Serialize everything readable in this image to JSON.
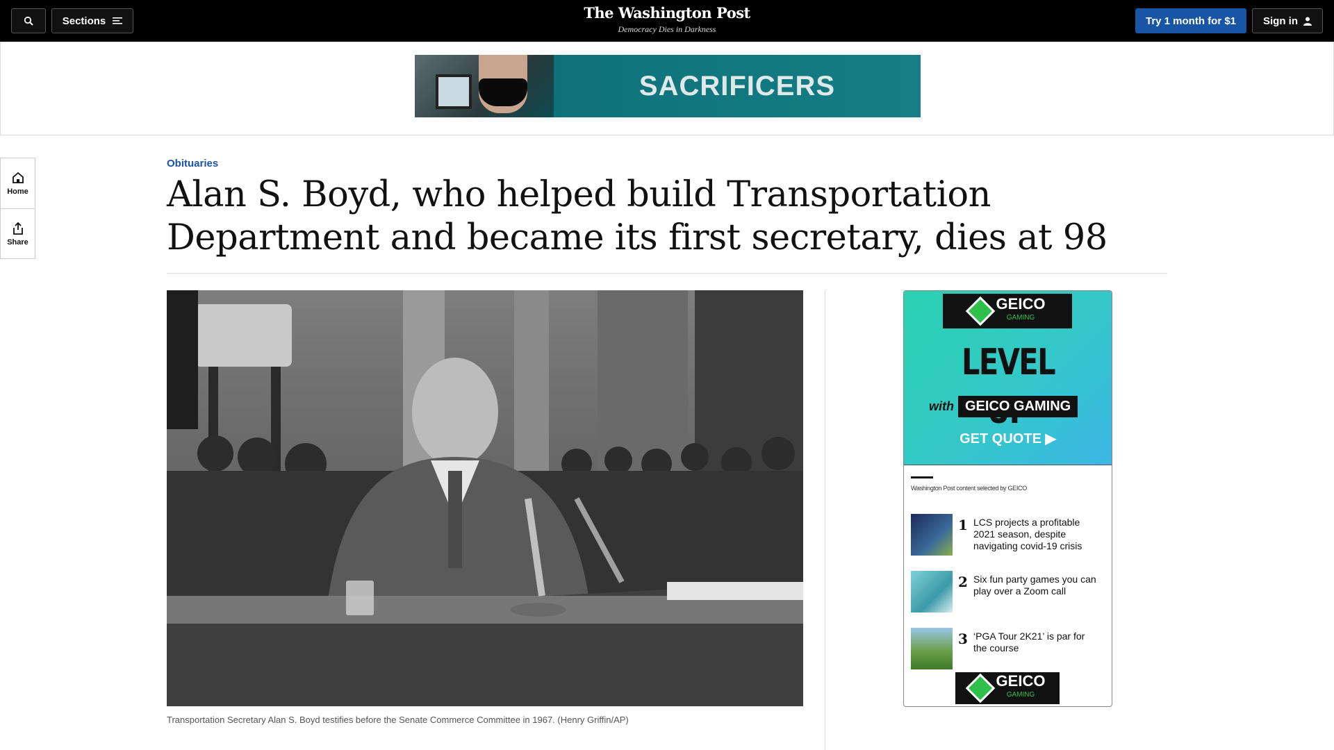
{
  "header": {
    "sections_label": "Sections",
    "logo_name": "The Washington Post",
    "logo_tagline": "Democracy Dies in Darkness",
    "subscribe_label": "Try 1 month for $1",
    "signin_label": "Sign in"
  },
  "top_ad": {
    "text": "SACRIFICERS"
  },
  "rail": {
    "home_label": "Home",
    "share_label": "Share"
  },
  "article": {
    "kicker": "Obituaries",
    "headline": "Alan S. Boyd, who helped build Transportation Department and became its first secretary, dies at 98",
    "caption": "Transportation Secretary Alan S. Boyd testifies before the Senate Commerce Committee in 1967. (Henry Griffin/AP)"
  },
  "side_ad": {
    "brand": "GEICO",
    "brand_sub": "GAMING",
    "headline": "LEVEL UP",
    "with": "with",
    "tagline": "GEICO GAMING",
    "cta": "GET QUOTE ▶",
    "selected_by": "Washington Post content selected by GEICO",
    "items": [
      {
        "num": "1",
        "text": "LCS projects a profitable 2021 season, despite navigating covid-19 crisis"
      },
      {
        "num": "2",
        "text": "Six fun party games you can play over a Zoom call"
      },
      {
        "num": "3",
        "text": "‘PGA Tour 2K21’ is par for the course"
      }
    ]
  },
  "colors": {
    "accent": "#1955a5",
    "topbar": "#000000",
    "geico_green": "#2fbf4b"
  }
}
